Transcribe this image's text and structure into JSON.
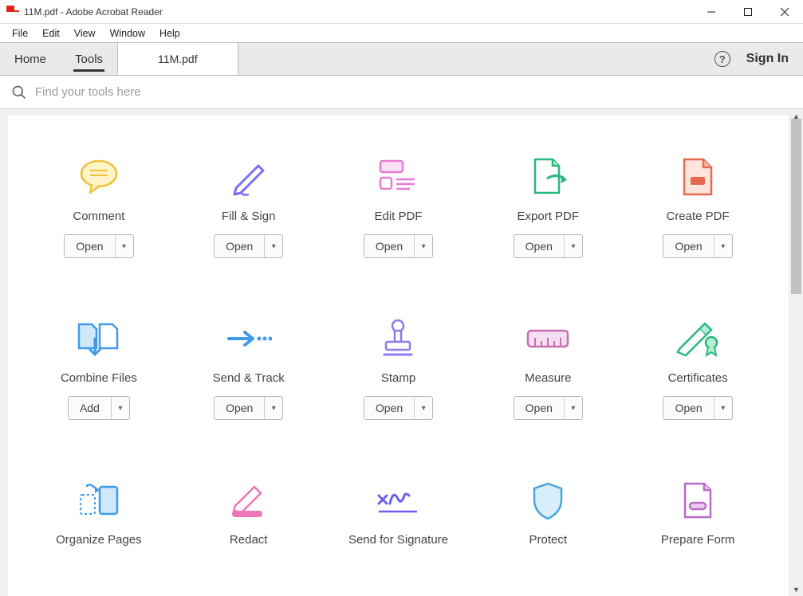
{
  "titlebar": {
    "text": "11M.pdf - Adobe Acrobat Reader"
  },
  "menubar": {
    "items": [
      "File",
      "Edit",
      "View",
      "Window",
      "Help"
    ]
  },
  "tabs": {
    "nav": [
      {
        "label": "Home",
        "active": false
      },
      {
        "label": "Tools",
        "active": true
      }
    ],
    "doc": "11M.pdf",
    "signin": "Sign In"
  },
  "search": {
    "placeholder": "Find your tools here"
  },
  "tools": [
    {
      "id": "comment",
      "label": "Comment",
      "button": "Open"
    },
    {
      "id": "fill-sign",
      "label": "Fill & Sign",
      "button": "Open"
    },
    {
      "id": "edit-pdf",
      "label": "Edit PDF",
      "button": "Open"
    },
    {
      "id": "export-pdf",
      "label": "Export PDF",
      "button": "Open"
    },
    {
      "id": "create-pdf",
      "label": "Create PDF",
      "button": "Open"
    },
    {
      "id": "combine-files",
      "label": "Combine Files",
      "button": "Add"
    },
    {
      "id": "send-track",
      "label": "Send & Track",
      "button": "Open"
    },
    {
      "id": "stamp",
      "label": "Stamp",
      "button": "Open"
    },
    {
      "id": "measure",
      "label": "Measure",
      "button": "Open"
    },
    {
      "id": "certificates",
      "label": "Certificates",
      "button": "Open"
    },
    {
      "id": "organize-pages",
      "label": "Organize Pages",
      "button": ""
    },
    {
      "id": "redact",
      "label": "Redact",
      "button": ""
    },
    {
      "id": "send-signature",
      "label": "Send for Signature",
      "button": ""
    },
    {
      "id": "protect",
      "label": "Protect",
      "button": ""
    },
    {
      "id": "prepare-form",
      "label": "Prepare Form",
      "button": ""
    }
  ]
}
